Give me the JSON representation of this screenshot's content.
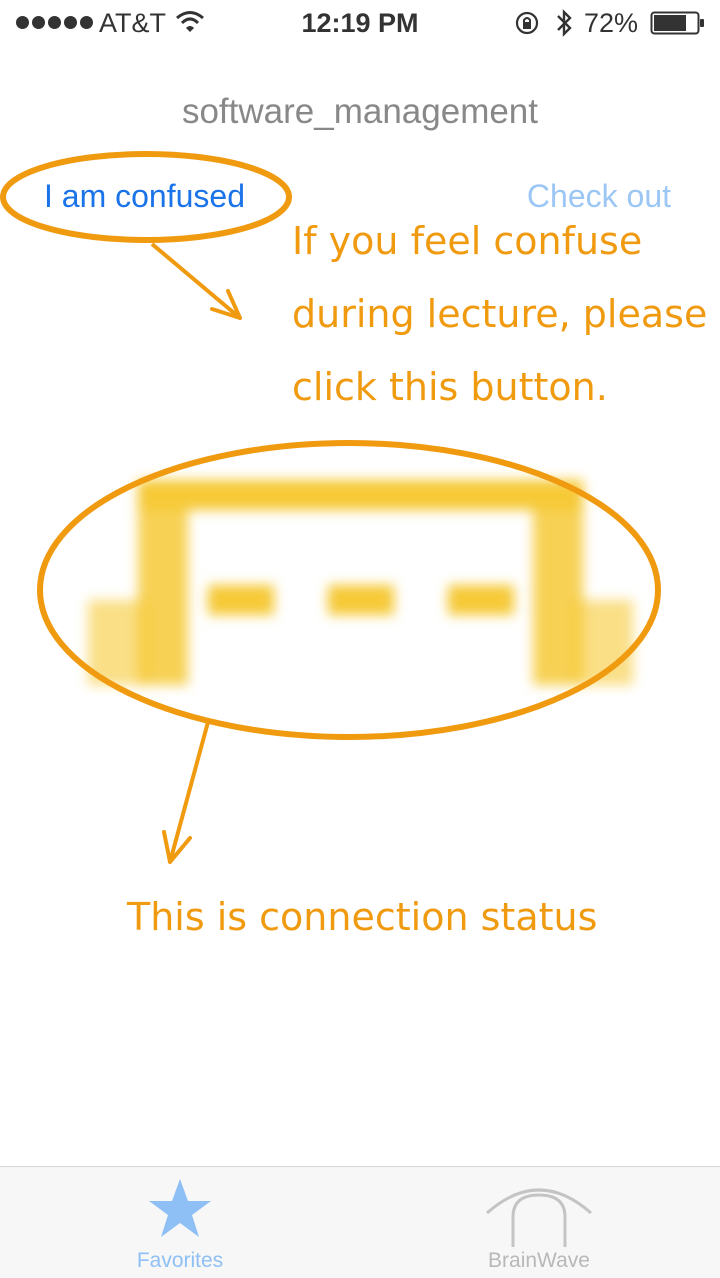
{
  "status_bar": {
    "carrier": "AT&T",
    "time": "12:19 PM",
    "battery": "72%",
    "icons": [
      "signal-icon",
      "wifi-icon",
      "rotation-lock-icon",
      "bluetooth-icon",
      "battery-icon"
    ]
  },
  "nav": {
    "title": "software_management",
    "left_button": "I am confused",
    "right_button": "Check out"
  },
  "annotations": {
    "button_note_lines": [
      "If you feel confuse",
      "during lecture, please",
      "click this button."
    ],
    "status_note": "This is connection status",
    "color": "#f09a10"
  },
  "connection_status": {
    "icon": "connection-status-icon",
    "color": "#f6c936"
  },
  "tab_bar": {
    "tabs": [
      {
        "label": "Favorites",
        "icon": "star-icon",
        "selected": true
      },
      {
        "label": "BrainWave",
        "icon": "brainwave-icon",
        "selected": false
      }
    ]
  },
  "colors": {
    "accent": "#1a73e8",
    "disabled": "#9cc6f4",
    "annotation": "#f09a10"
  }
}
